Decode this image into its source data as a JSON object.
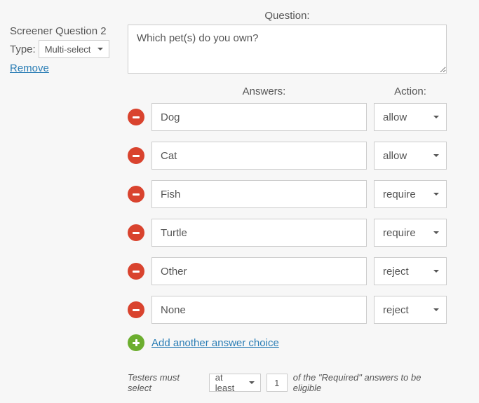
{
  "left": {
    "title": "Screener Question 2",
    "type_label": "Type:",
    "type_value": "Multi-select",
    "remove_label": "Remove"
  },
  "question": {
    "label": "Question:",
    "value": "Which pet(s) do you own?"
  },
  "answers_header": {
    "answers_label": "Answers:",
    "action_label": "Action:"
  },
  "answers": [
    {
      "text": "Dog",
      "action": "allow"
    },
    {
      "text": "Cat",
      "action": "allow"
    },
    {
      "text": "Fish",
      "action": "require"
    },
    {
      "text": "Turtle",
      "action": "require"
    },
    {
      "text": "Other",
      "action": "reject"
    },
    {
      "text": "None",
      "action": "reject"
    }
  ],
  "add_label": "Add another answer choice",
  "requirement": {
    "prefix": "Testers must select",
    "mode": "at least",
    "count": "1",
    "suffix": "of the \"Required\" answers to be eligible"
  }
}
